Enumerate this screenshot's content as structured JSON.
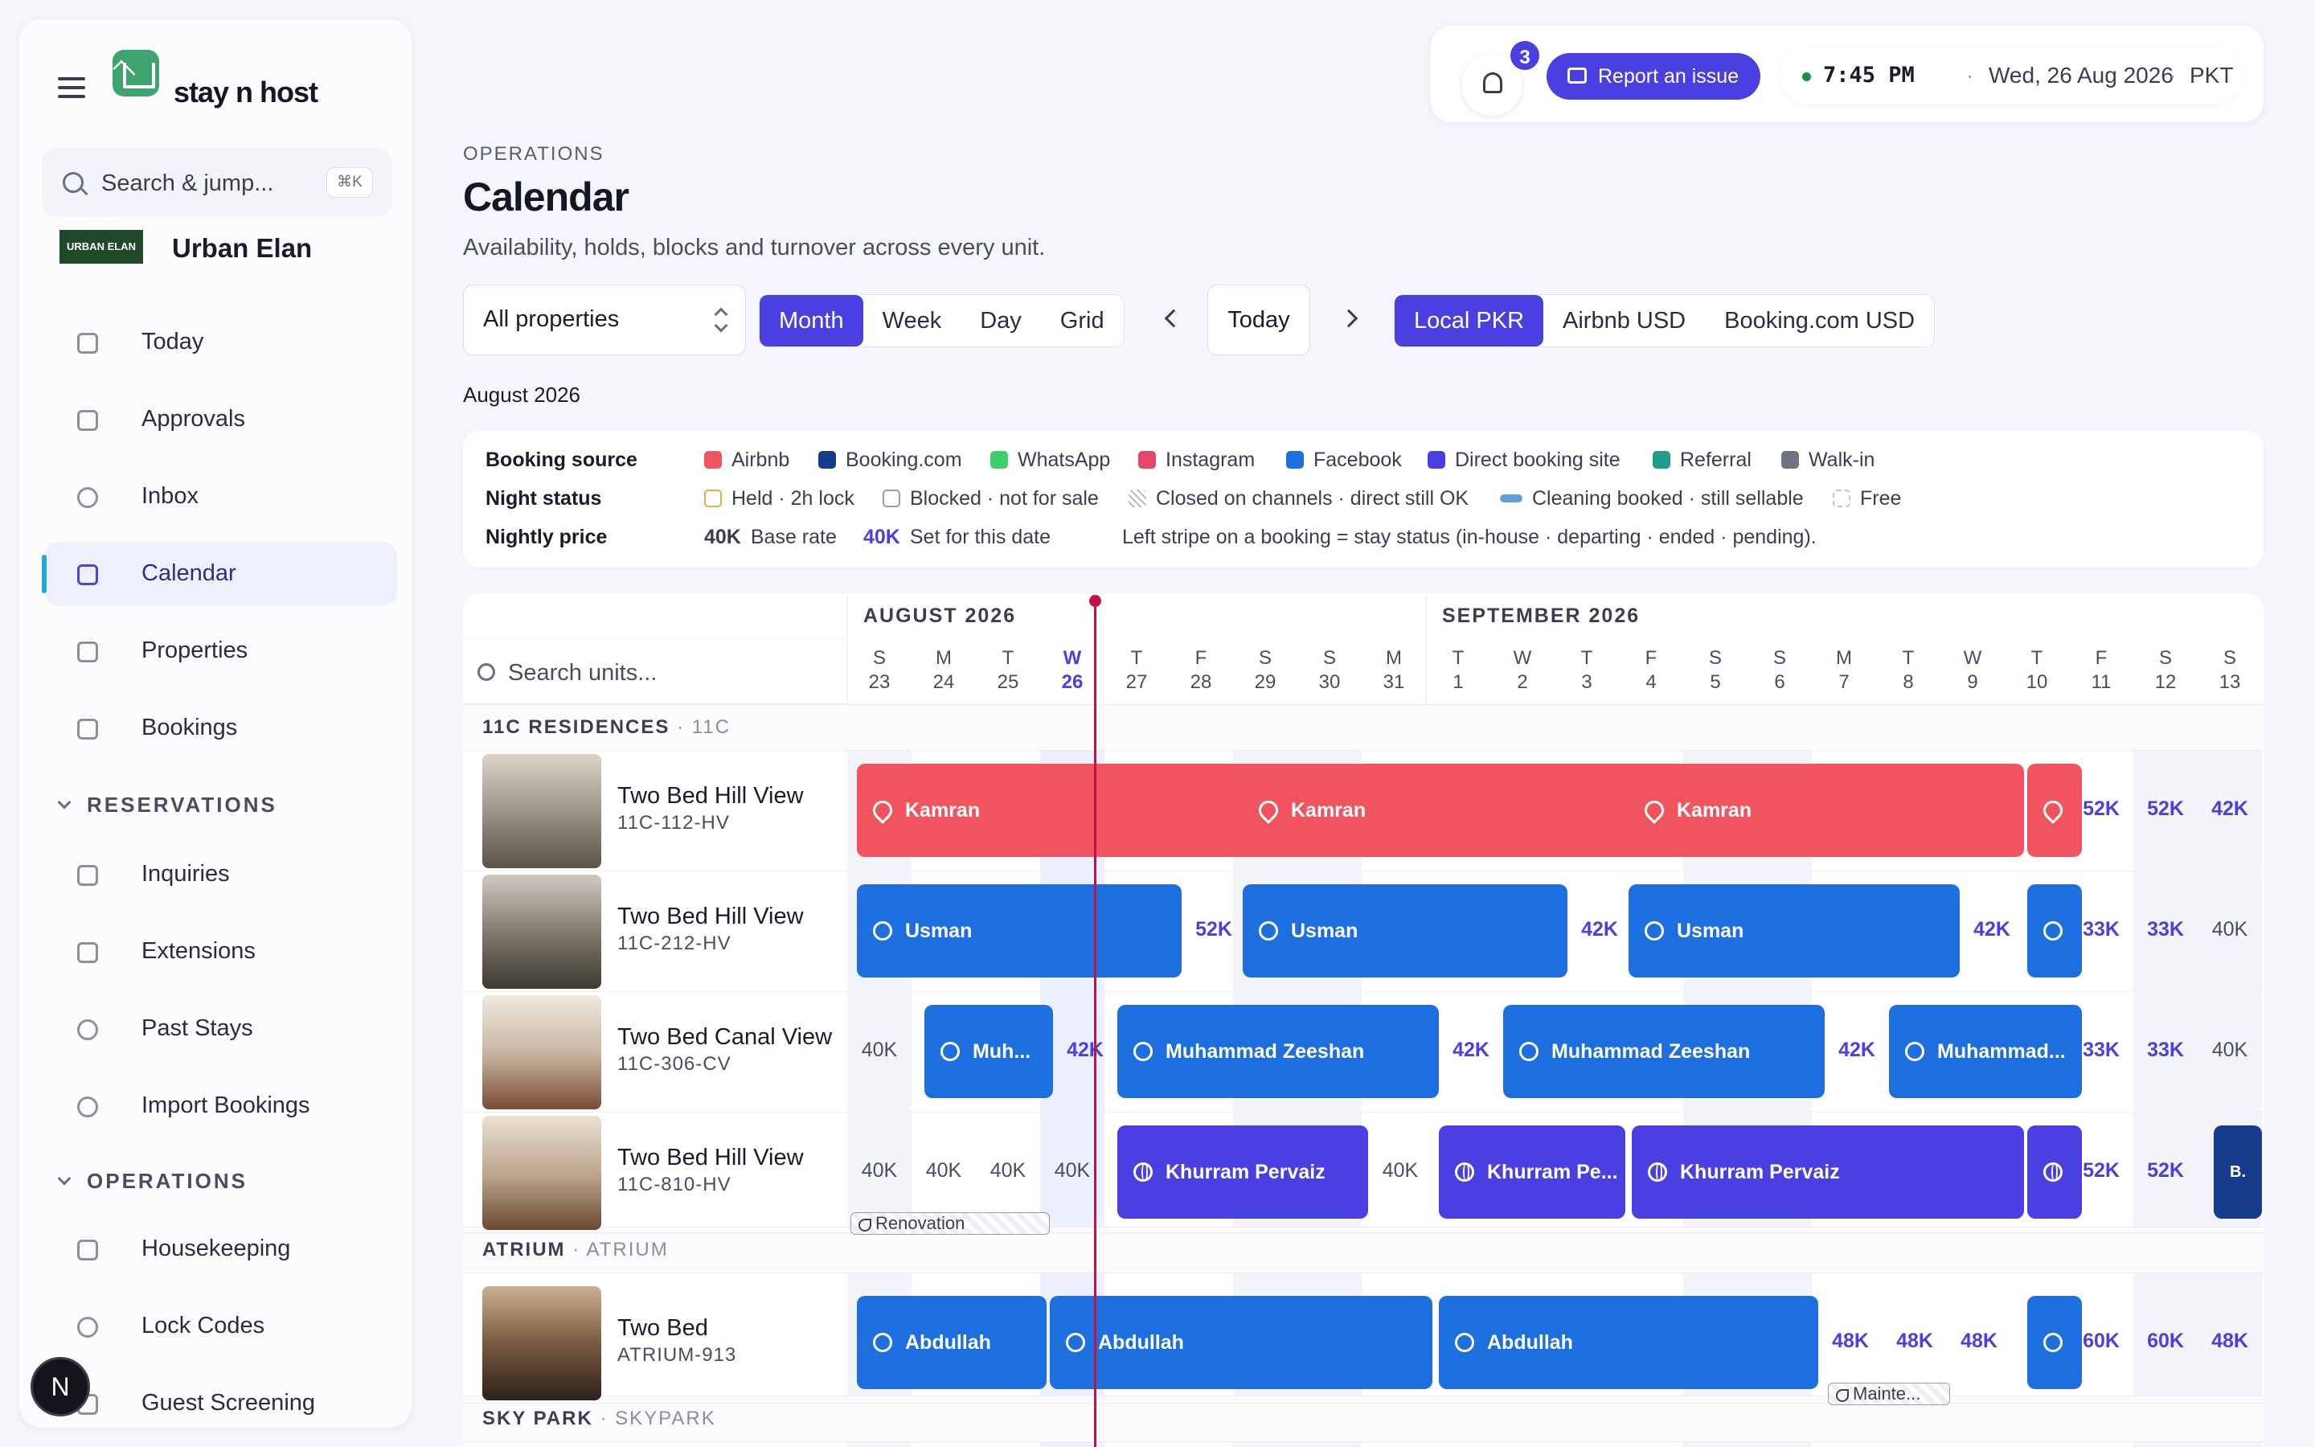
{
  "app": {
    "name": "stay n host",
    "org_logo_text": "URBAN ELAN",
    "org_name": "Urban Elan"
  },
  "search": {
    "placeholder": "Search & jump...",
    "shortcut": "⌘K"
  },
  "nav": {
    "items": [
      {
        "label": "Today",
        "icon": "grid-icon"
      },
      {
        "label": "Approvals",
        "icon": "clipboard-check-icon"
      },
      {
        "label": "Inbox",
        "icon": "message-icon"
      },
      {
        "label": "Calendar",
        "icon": "calendar-icon",
        "active": true
      },
      {
        "label": "Properties",
        "icon": "building-icon"
      },
      {
        "label": "Bookings",
        "icon": "calendar-check-icon"
      }
    ],
    "reservations_label": "RESERVATIONS",
    "reservations": [
      {
        "label": "Inquiries",
        "icon": "inbox-icon"
      },
      {
        "label": "Extensions",
        "icon": "calendar-plus-icon"
      },
      {
        "label": "Past Stays",
        "icon": "history-icon"
      },
      {
        "label": "Import Bookings",
        "icon": "cloud-download-icon"
      }
    ],
    "operations_label": "OPERATIONS",
    "operations": [
      {
        "label": "Housekeeping",
        "icon": "sparkles-icon"
      },
      {
        "label": "Lock Codes",
        "icon": "key-icon"
      },
      {
        "label": "Guest Screening",
        "icon": "shield-icon"
      }
    ]
  },
  "topbar": {
    "notifications": "3",
    "report_label": "Report an issue",
    "time": "7:45 PM",
    "date": "Wed, 26 Aug 2026",
    "timezone": "PKT",
    "sep": "·"
  },
  "header": {
    "eyebrow": "OPERATIONS",
    "title": "Calendar",
    "subtitle": "Availability, holds, blocks and turnover across every unit."
  },
  "controls": {
    "property_filter": "All properties",
    "views": [
      "Month",
      "Week",
      "Day",
      "Grid"
    ],
    "active_view": "Month",
    "today_label": "Today",
    "currencies": [
      "Local PKR",
      "Airbnb USD",
      "Booking.com USD"
    ],
    "active_currency": "Local PKR",
    "month_label": "August 2026"
  },
  "legend": {
    "booking_source_label": "Booking source",
    "sources": [
      {
        "label": "Airbnb",
        "color": "#f0555f"
      },
      {
        "label": "Booking.com",
        "color": "#163d8c"
      },
      {
        "label": "WhatsApp",
        "color": "#3ccf6a"
      },
      {
        "label": "Instagram",
        "color": "#e8476a"
      },
      {
        "label": "Facebook",
        "color": "#1d6fe0"
      },
      {
        "label": "Direct booking site",
        "color": "#4a3fe0"
      },
      {
        "label": "Referral",
        "color": "#1e9e8a"
      },
      {
        "label": "Walk-in",
        "color": "#6e7385"
      }
    ],
    "night_status_label": "Night status",
    "statuses": [
      "Held · 2h lock",
      "Blocked · not for sale",
      "Closed on channels · direct still OK",
      "Cleaning booked · still sellable",
      "Free"
    ],
    "nightly_price_label": "Nightly price",
    "base_value": "40K",
    "base_label": "Base rate",
    "set_value": "40K",
    "set_label": "Set for this date",
    "stripe_note": "Left stripe on a booking = stay status (in-house · departing · ended · pending)."
  },
  "calendar": {
    "unit_search_placeholder": "Search units...",
    "month1": "AUGUST 2026",
    "month2": "SEPTEMBER 2026",
    "days": [
      {
        "d": "S",
        "n": "23"
      },
      {
        "d": "M",
        "n": "24"
      },
      {
        "d": "T",
        "n": "25"
      },
      {
        "d": "W",
        "n": "26"
      },
      {
        "d": "T",
        "n": "27"
      },
      {
        "d": "F",
        "n": "28"
      },
      {
        "d": "S",
        "n": "29"
      },
      {
        "d": "S",
        "n": "30"
      },
      {
        "d": "M",
        "n": "31"
      },
      {
        "d": "T",
        "n": "1"
      },
      {
        "d": "W",
        "n": "2"
      },
      {
        "d": "T",
        "n": "3"
      },
      {
        "d": "F",
        "n": "4"
      },
      {
        "d": "S",
        "n": "5"
      },
      {
        "d": "S",
        "n": "6"
      },
      {
        "d": "M",
        "n": "7"
      },
      {
        "d": "T",
        "n": "8"
      },
      {
        "d": "W",
        "n": "9"
      },
      {
        "d": "T",
        "n": "10"
      },
      {
        "d": "F",
        "n": "11"
      },
      {
        "d": "S",
        "n": "12"
      },
      {
        "d": "S",
        "n": "13"
      }
    ],
    "groups": [
      {
        "name": "11C RESIDENCES",
        "code": "11C"
      },
      {
        "name": "ATRIUM",
        "code": "ATRIUM"
      },
      {
        "name": "SKY PARK",
        "code": "SKYPARK"
      }
    ],
    "units": [
      {
        "name": "Two Bed Hill View",
        "code": "11C-112-HV",
        "bars": [
          {
            "guest": "Kamran",
            "source": "airbnb"
          },
          {
            "guest": "Kamran",
            "source": "airbnb"
          },
          {
            "guest": "Kamran",
            "source": "airbnb"
          },
          {
            "guest": "",
            "source": "airbnb"
          }
        ],
        "prices": [
          "52K",
          "52K",
          "42K"
        ]
      },
      {
        "name": "Two Bed Hill View",
        "code": "11C-212-HV",
        "bars": [
          {
            "guest": "Usman",
            "source": "facebook"
          },
          {
            "guest": "Usman",
            "source": "facebook"
          },
          {
            "guest": "Usman",
            "source": "facebook"
          },
          {
            "guest": "",
            "source": "facebook"
          }
        ],
        "prices": [
          "52K",
          "42K",
          "42K",
          "33K",
          "33K",
          "40K"
        ]
      },
      {
        "name": "Two Bed Canal View",
        "code": "11C-306-CV",
        "bars": [
          {
            "guest": "Muh...",
            "source": "facebook"
          },
          {
            "guest": "Muhammad Zeeshan",
            "source": "facebook"
          },
          {
            "guest": "Muhammad Zeeshan",
            "source": "facebook"
          },
          {
            "guest": "Muhammad...",
            "source": "facebook"
          }
        ],
        "prices": [
          "40K",
          "42K",
          "42K",
          "42K",
          "33K",
          "33K",
          "40K"
        ]
      },
      {
        "name": "Two Bed Hill View",
        "code": "11C-810-HV",
        "bars": [
          {
            "guest": "Khurram Pervaiz",
            "source": "direct"
          },
          {
            "guest": "Khurram Pe...",
            "source": "direct"
          },
          {
            "guest": "Khurram Pervaiz",
            "source": "direct"
          },
          {
            "guest": "",
            "source": "direct"
          },
          {
            "guest": "B.",
            "source": "booking"
          }
        ],
        "prices": [
          "40K",
          "40K",
          "40K",
          "40K",
          "40K",
          "52K",
          "52K"
        ],
        "tag": "Renovation"
      },
      {
        "name": "Two Bed",
        "code": "ATRIUM-913",
        "bars": [
          {
            "guest": "Abdullah",
            "source": "facebook"
          },
          {
            "guest": "Abdullah",
            "source": "facebook"
          },
          {
            "guest": "Abdullah",
            "source": "facebook"
          },
          {
            "guest": "",
            "source": "facebook"
          }
        ],
        "prices": [
          "48K",
          "48K",
          "48K",
          "60K",
          "60K",
          "48K"
        ],
        "tag": "Mainte..."
      }
    ]
  },
  "user_avatar": "N"
}
